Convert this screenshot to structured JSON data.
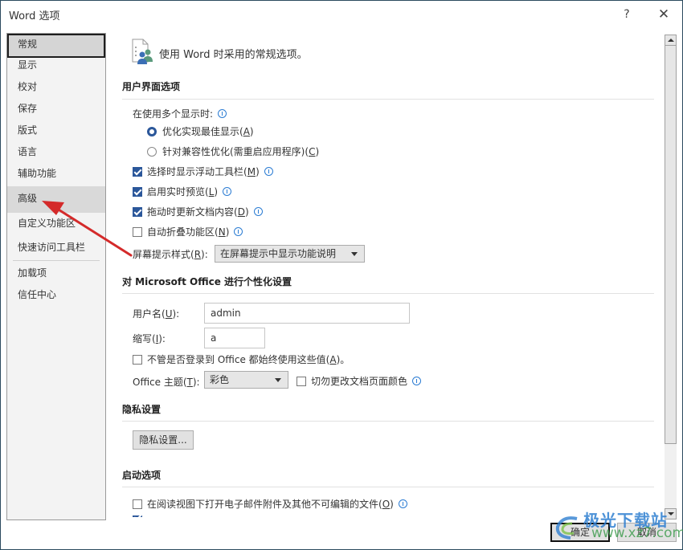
{
  "window": {
    "title": "Word 选项",
    "help_label": "?",
    "close_label": "✕"
  },
  "sidebar": {
    "items": [
      {
        "label": "常规",
        "state": "selected"
      },
      {
        "label": "显示"
      },
      {
        "label": "校对"
      },
      {
        "label": "保存"
      },
      {
        "label": "版式"
      },
      {
        "label": "语言"
      },
      {
        "label": "辅助功能"
      },
      {
        "label": "高级",
        "state": "hover"
      },
      {
        "label": "自定义功能区"
      },
      {
        "label": "快速访问工具栏"
      },
      {
        "label": "加载项"
      },
      {
        "label": "信任中心"
      }
    ]
  },
  "content": {
    "header_icon": "general-options-icon",
    "header_text": "使用 Word 时采用的常规选项。",
    "ui_section": {
      "title": "用户界面选项",
      "multi_display_label": "在使用多个显示时:",
      "radio_options": [
        {
          "label": "优化实现最佳显示",
          "accel": "A",
          "selected": true
        },
        {
          "label": "针对兼容性优化(需重启应用程序)",
          "accel": "C",
          "selected": false
        }
      ],
      "checkboxes": [
        {
          "label": "选择时显示浮动工具栏",
          "accel": "M",
          "checked": true
        },
        {
          "label": "启用实时预览",
          "accel": "L",
          "checked": true
        },
        {
          "label": "拖动时更新文档内容",
          "accel": "D",
          "checked": true
        },
        {
          "label": "自动折叠功能区",
          "accel": "N",
          "checked": false
        }
      ],
      "screentip_label": "屏幕提示样式",
      "screentip_accel": "R",
      "screentip_value": "在屏幕提示中显示功能说明"
    },
    "personalize_section": {
      "title": "对 Microsoft Office 进行个性化设置",
      "username_label": "用户名",
      "username_accel": "U",
      "username_value": "admin",
      "initials_label": "缩写",
      "initials_accel": "I",
      "initials_value": "a",
      "always_use_label": "不管是否登录到 Office 都始终使用这些值",
      "always_use_accel": "A",
      "always_use_checked": false,
      "theme_label": "Office 主题",
      "theme_accel": "T",
      "theme_value": "彩色",
      "no_change_page_color_label": "切勿更改文档页面颜色",
      "no_change_page_color_checked": false
    },
    "privacy_section": {
      "title": "隐私设置",
      "button_label": "隐私设置..."
    },
    "startup_section": {
      "title": "启动选项",
      "checkboxes": [
        {
          "label": "在阅读视图下打开电子邮件附件及其他不可编辑的文件",
          "accel": "O",
          "checked": false
        },
        {
          "label": "",
          "checked": true
        }
      ]
    }
  },
  "footer": {
    "ok_label": "确定",
    "cancel_label": "取消"
  },
  "annotation": {
    "arrow_color": "#d42a2a",
    "points_to": "高级"
  },
  "watermark": {
    "cn_text": "极光下载站",
    "url_text": "www.xz7.com"
  },
  "colors": {
    "accent": "#2b579a",
    "info": "#2b7cd3",
    "border": "#2b4a5e"
  }
}
